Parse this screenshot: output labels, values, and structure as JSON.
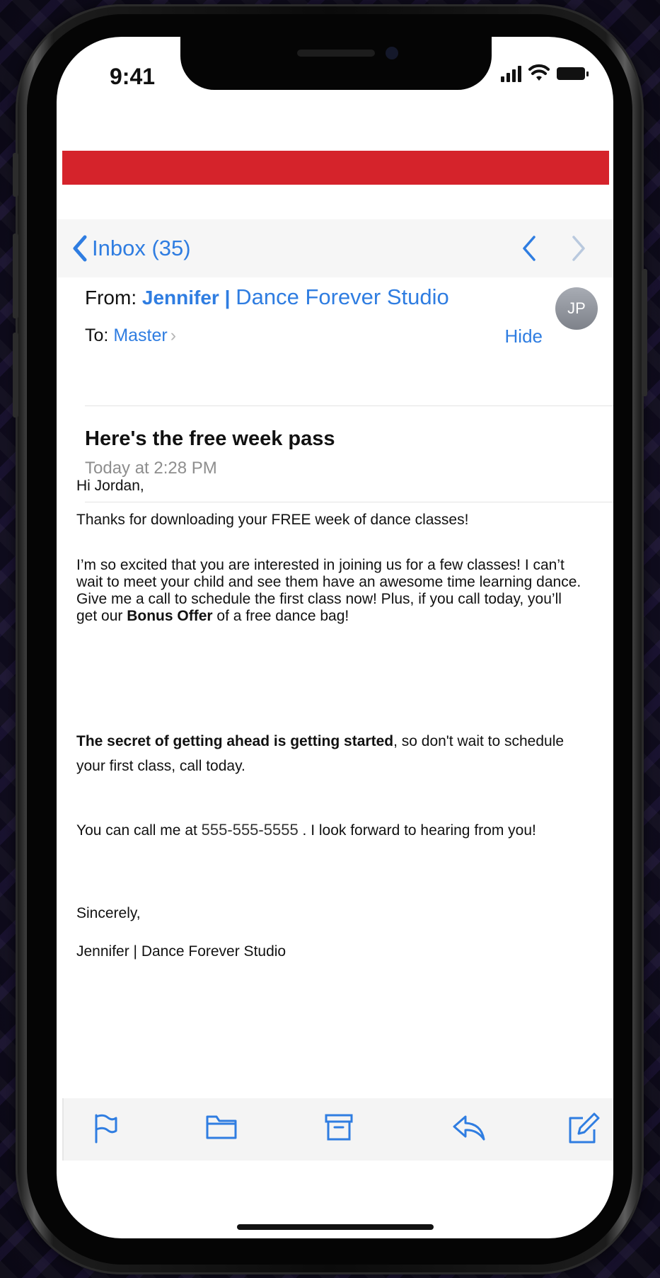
{
  "status_bar": {
    "time": "9:41"
  },
  "nav": {
    "back_label": "Inbox (35)"
  },
  "header": {
    "from_label": "From:",
    "from_name": "Jennifer |",
    "from_studio": "Dance Forever Studio",
    "to_label": "To:",
    "to_name": "Master",
    "hide_label": "Hide",
    "avatar_initials": "JP"
  },
  "email": {
    "subject": "Here's the free week pass",
    "date": "Today at 2:28 PM",
    "greeting": "Hi Jordan,",
    "p1": "Thanks for downloading your FREE week of dance classes!",
    "p2_text": "I’m so excited that you are interested in joining us for a few classes! I can’t wait to meet your child and see them have an awesome time learning dance. Give me a call to schedule the first class now! Plus, if you call today, you’ll get our ",
    "p2_bold": "Bonus Offer",
    "p2_end": " of a free dance bag!",
    "p3_bold": "The secret of getting ahead is getting started",
    "p3_text": ", so don't wait to schedule your first class, call today.",
    "p4_start": "You can call me at ",
    "phone": "555-555-5555",
    "p4_end": " . I look forward to hearing from you!",
    "closing": "Sincerely,",
    "signature": "Jennifer | Dance Forever Studio"
  },
  "toolbar": {
    "icons": [
      "flag-icon",
      "folder-icon",
      "archive-icon",
      "reply-icon",
      "compose-icon"
    ]
  },
  "colors": {
    "accent": "#2f7de1",
    "banner": "#d5232b",
    "text": "#111111",
    "secondary_text": "#8e8e8e"
  }
}
